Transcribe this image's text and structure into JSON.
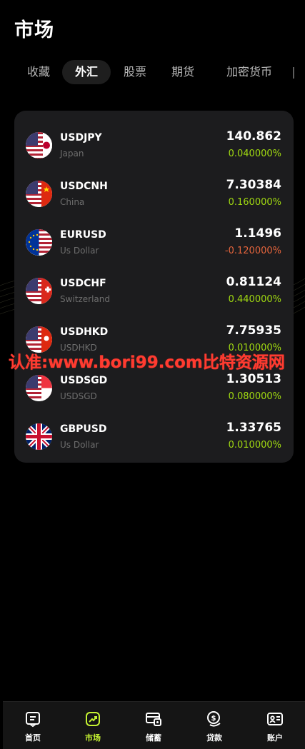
{
  "page": {
    "title": "市场"
  },
  "tabs": [
    {
      "label": "收藏",
      "active": false
    },
    {
      "label": "外汇",
      "active": true
    },
    {
      "label": "股票",
      "active": false
    },
    {
      "label": "期货",
      "active": false
    },
    {
      "label": "加密货币",
      "active": false
    }
  ],
  "quotes": [
    {
      "symbol": "USDJPY",
      "name": "Japan",
      "price": "140.862",
      "change": "0.040000%",
      "direction": "up",
      "flag": "us-jp-flag"
    },
    {
      "symbol": "USDCNH",
      "name": "China",
      "price": "7.30384",
      "change": "0.160000%",
      "direction": "up",
      "flag": "us-cn-flag"
    },
    {
      "symbol": "EURUSD",
      "name": "Us Dollar",
      "price": "1.1496",
      "change": "-0.120000%",
      "direction": "down",
      "flag": "eu-us-flag"
    },
    {
      "symbol": "USDCHF",
      "name": "Switzerland",
      "price": "0.81124",
      "change": "0.440000%",
      "direction": "up",
      "flag": "us-ch-flag"
    },
    {
      "symbol": "USDHKD",
      "name": "USDHKD",
      "price": "7.75935",
      "change": "0.010000%",
      "direction": "up",
      "flag": "us-hk-flag"
    },
    {
      "symbol": "USDSGD",
      "name": "USDSGD",
      "price": "1.30513",
      "change": "0.080000%",
      "direction": "up",
      "flag": "us-sg-flag"
    },
    {
      "symbol": "GBPUSD",
      "name": "Us Dollar",
      "price": "1.33765",
      "change": "0.010000%",
      "direction": "up",
      "flag": "gb-us-flag"
    }
  ],
  "watermark": "认准:www.bori99.com比特资源网",
  "nav": [
    {
      "label": "首页",
      "icon": "home-icon",
      "active": false
    },
    {
      "label": "市场",
      "icon": "market-icon",
      "active": true
    },
    {
      "label": "储蓄",
      "icon": "savings-icon",
      "active": false
    },
    {
      "label": "贷款",
      "icon": "loan-icon",
      "active": false
    },
    {
      "label": "账户",
      "icon": "account-icon",
      "active": false
    }
  ],
  "colors": {
    "up": "#a0d911",
    "down": "#e4643c",
    "accent": "#c6f432",
    "card": "#1c1c1e"
  }
}
